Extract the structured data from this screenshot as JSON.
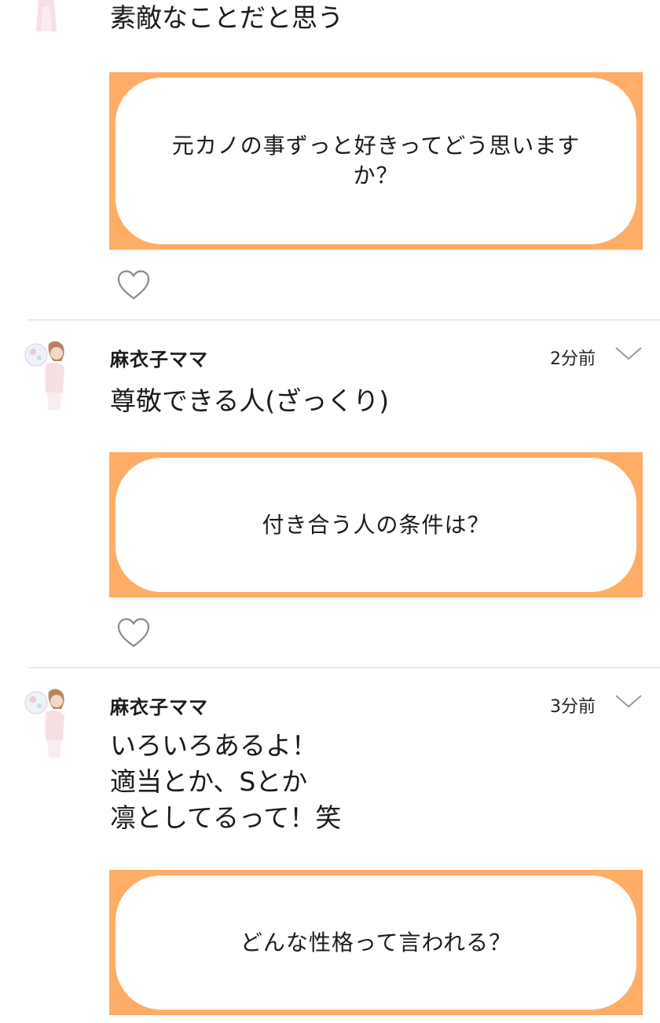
{
  "posts": [
    {
      "author": "",
      "time": "",
      "body": "素敵なことだと思う",
      "question": "元カノの事ずっと好きってどう思いますか？"
    },
    {
      "author": "麻衣子ママ",
      "time": "2分前",
      "body": "尊敬できる人(ざっくり)",
      "question": "付き合う人の条件は？"
    },
    {
      "author": "麻衣子ママ",
      "time": "3分前",
      "body": "いろいろあるよ！\n適当とか、Sとか\n凛としてるって！笑",
      "question": "どんな性格って言われる？"
    }
  ],
  "icons": {
    "like": "heart-outline-icon",
    "menu": "chevron-down-icon",
    "avatar": "avatar"
  },
  "colors": {
    "card_border": "#ffac66",
    "divider": "#d6d6d6",
    "icon_gray": "#9a9a9a"
  }
}
